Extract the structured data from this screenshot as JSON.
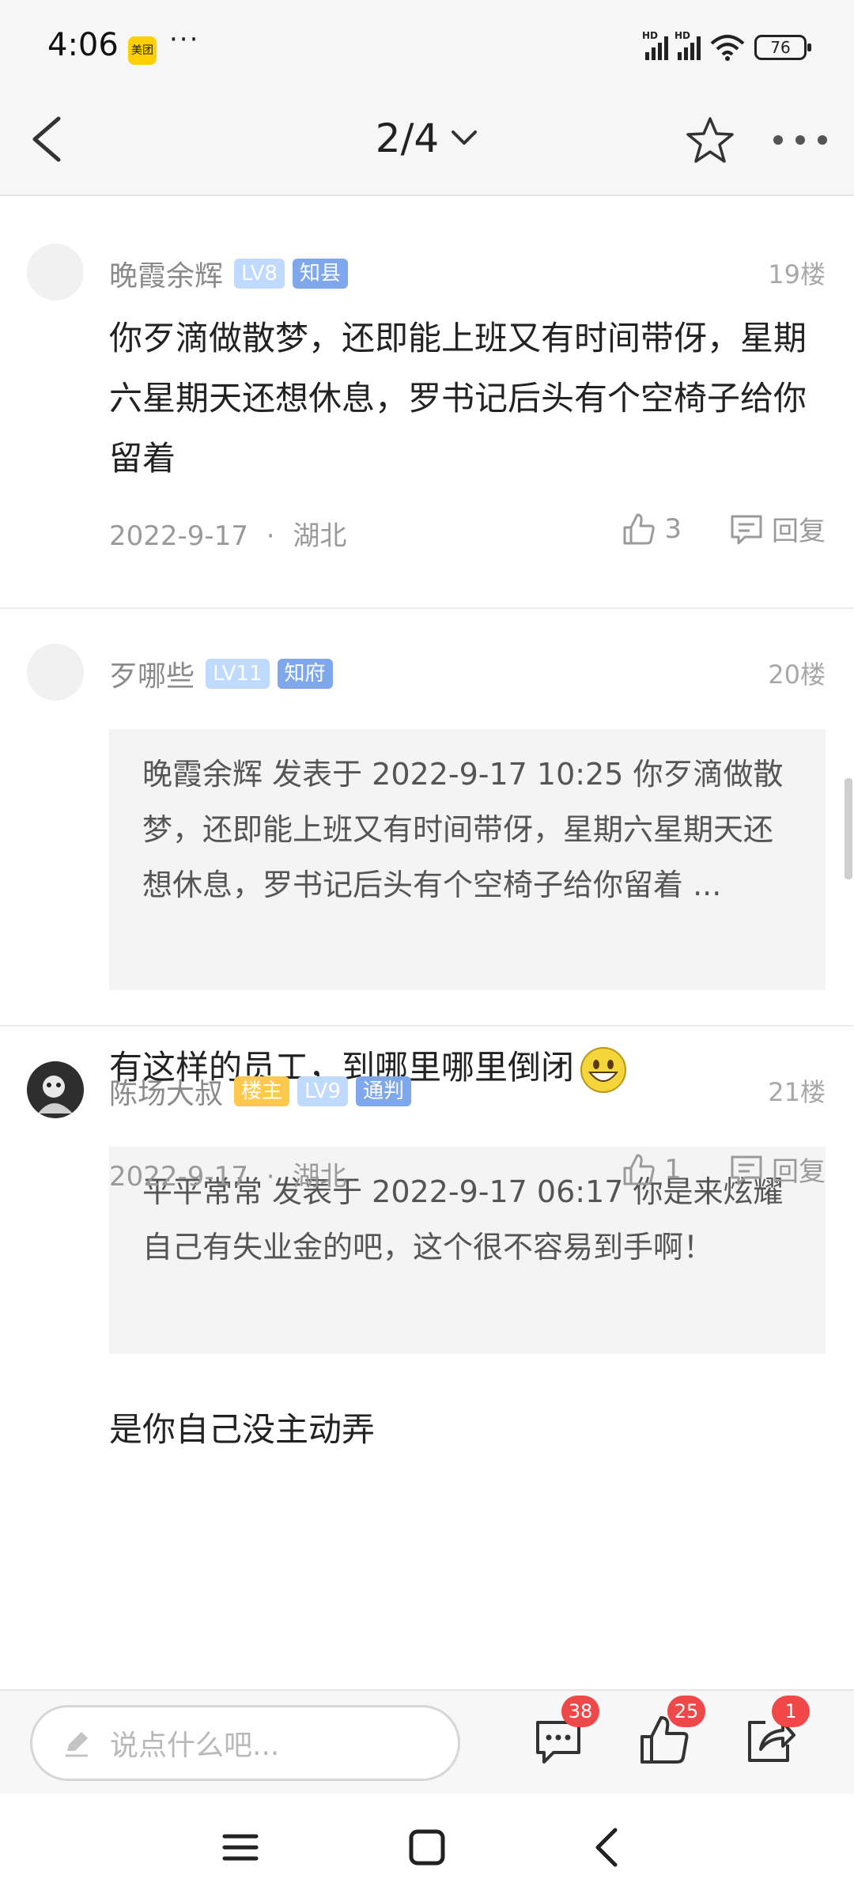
{
  "status_bar": {
    "time": "4:06",
    "app_badge": "美团",
    "more": "···",
    "battery": "76",
    "icons": [
      "hd-signal-icon",
      "hd-signal-icon",
      "wifi-icon",
      "battery-icon"
    ]
  },
  "nav": {
    "page_indicator": "2/4",
    "icons": [
      "back-arrow-icon",
      "chevron-down-icon",
      "star-icon",
      "more-dots-icon"
    ]
  },
  "posts": [
    {
      "username": "晚霞余辉",
      "badges": [
        "LV8",
        "知县"
      ],
      "floor": "19楼",
      "text": "你歹滴做散梦，还即能上班又有时间带伢，星期六星期天还想休息，罗书记后头有个空椅子给你留着",
      "date": "2022-9-17",
      "location": "湖北",
      "likes": "3",
      "reply_label": "回复"
    },
    {
      "username": "歹哪些",
      "badges": [
        "LV11",
        "知府"
      ],
      "floor": "20楼",
      "quote": "晚霞余辉 发表于 2022-9-17 10:25 你歹滴做散梦，还即能上班又有时间带伢，星期六星期天还想休息，罗书记后头有个空椅子给你留着 ...",
      "text": "有这样的员工，到哪里哪里倒闭",
      "date": "2022-9-17",
      "location": "湖北",
      "likes": "1",
      "reply_label": "回复"
    },
    {
      "username": "陈场大叔",
      "badges": [
        "楼主",
        "LV9",
        "通判"
      ],
      "floor": "21楼",
      "quote": "平平常常 发表于 2022-9-17 06:17 你是来炫耀自己有失业金的吧，这个很不容易到手啊！",
      "text": "是你自己没主动弄"
    }
  ],
  "separator": "·",
  "bottom_bar": {
    "input_placeholder": "说点什么吧...",
    "comments_count": "38",
    "likes_count": "25",
    "shares_count": "1"
  },
  "colors": {
    "badge_level": "#bfd9ff",
    "badge_rank": "#7fa8ec",
    "badge_host": "#ffc94e",
    "notify_red": "#f04848"
  }
}
